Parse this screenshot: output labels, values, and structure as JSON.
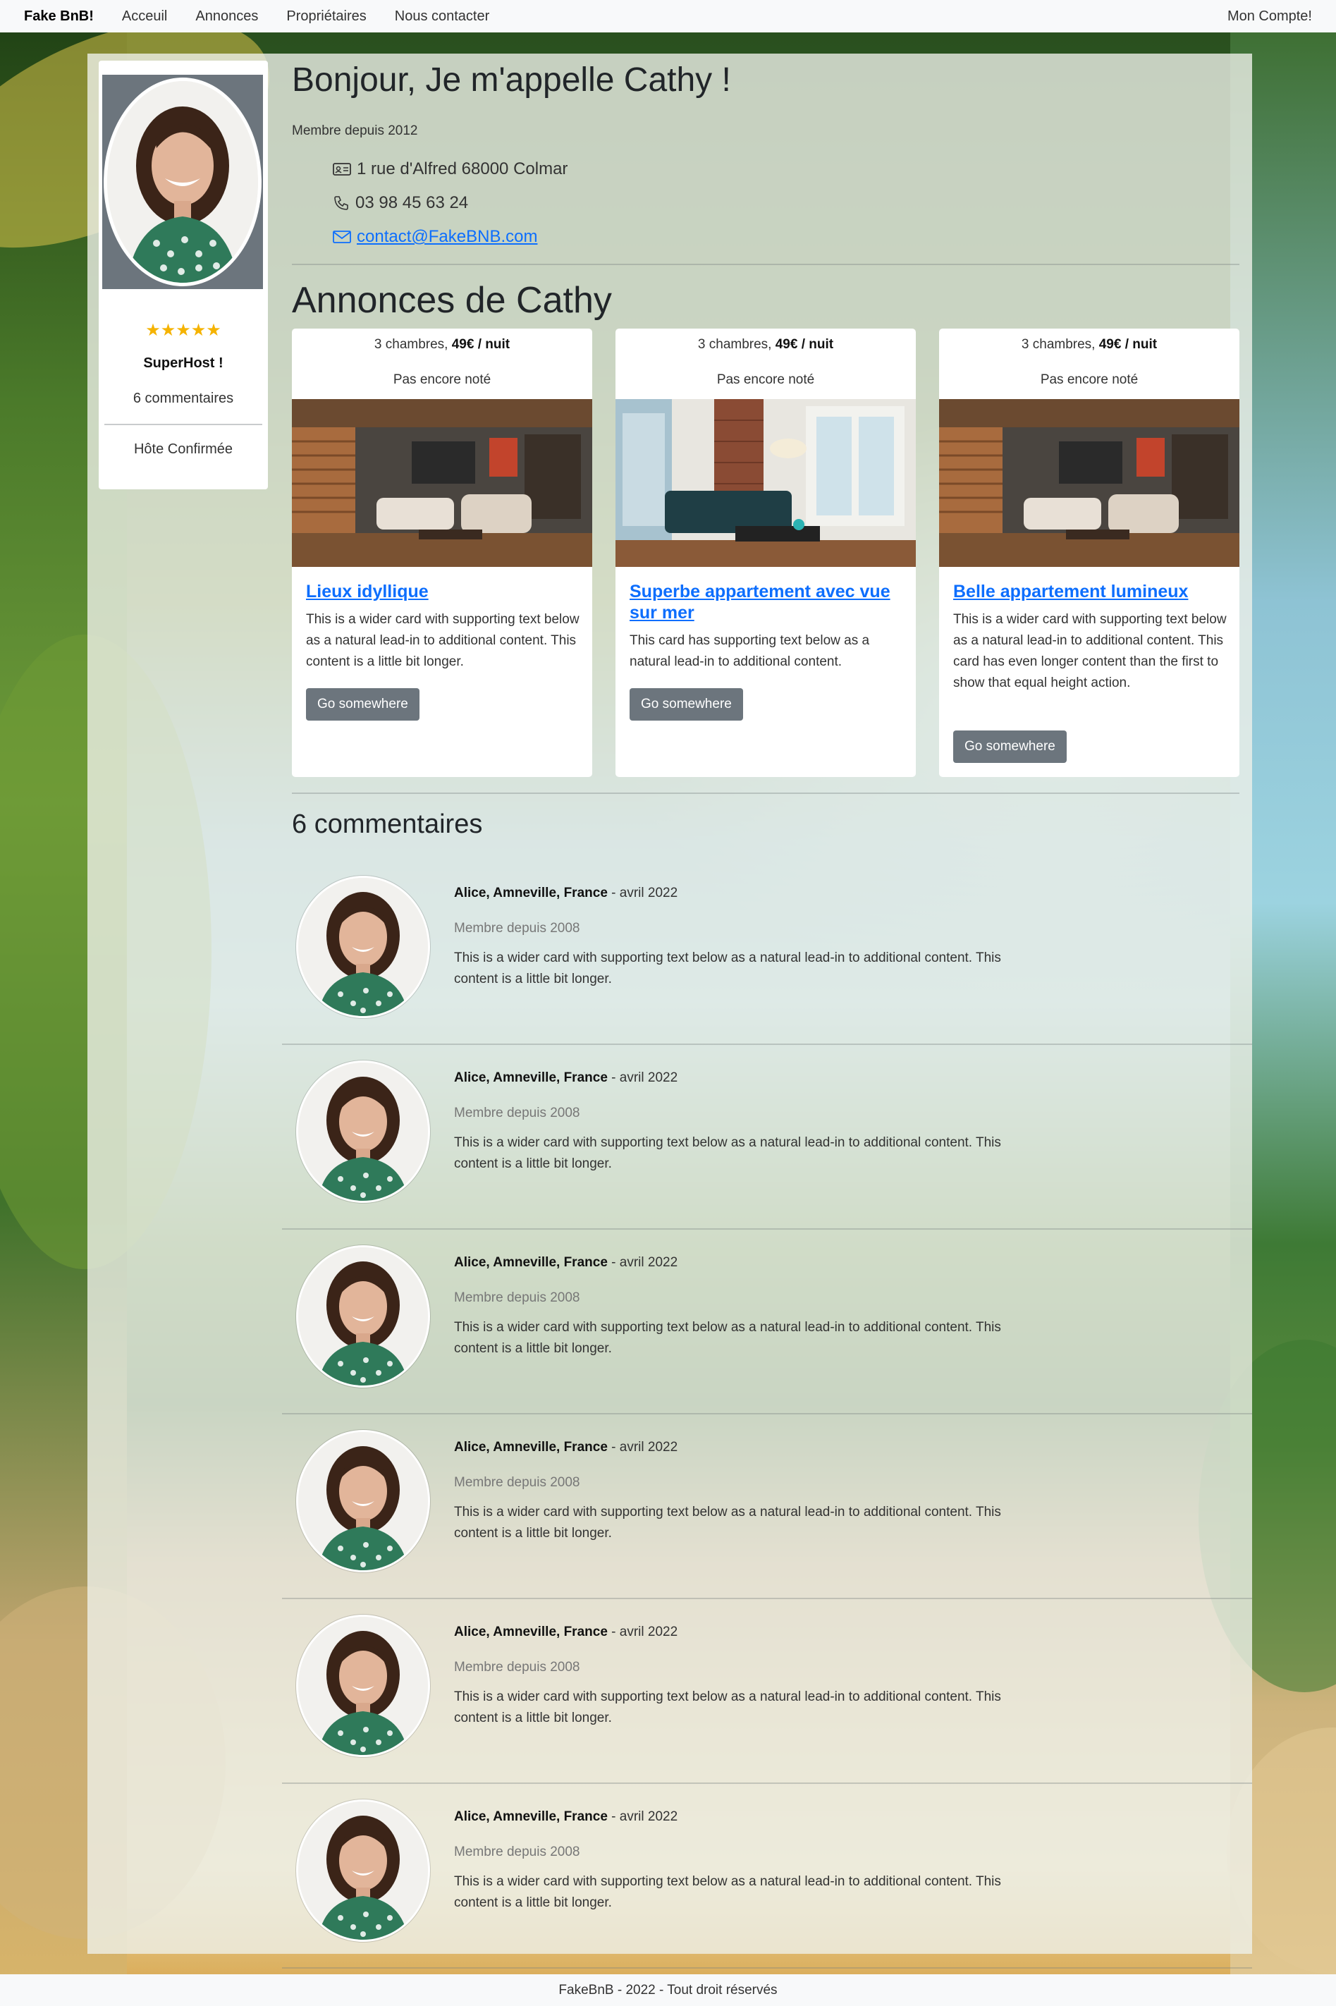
{
  "navbar": {
    "brand": "Fake BnB!",
    "links": [
      "Acceuil",
      "Annonces",
      "Propriétaires",
      "Nous contacter"
    ],
    "account": "Mon Compte!"
  },
  "profile": {
    "stars": "★★★★★",
    "badge": "SuperHost !",
    "comments_count": "6 commentaires",
    "status": "Hôte Confirmée"
  },
  "header": {
    "title": "Bonjour, Je m'appelle Cathy !",
    "member_since": "Membre depuis 2012",
    "address": "1 rue d'Alfred 68000 Colmar",
    "phone": "03 98 45 63 24",
    "email": "contact@FakeBNB.com"
  },
  "listings": {
    "heading": "Annonces de Cathy",
    "items": [
      {
        "rooms": "3 chambres, ",
        "price": "49€ / nuit",
        "rating": "Pas encore noté",
        "title": "Lieux idyllique",
        "text": "This is a wider card with supporting text below as a natural lead-in to additional content. This content is a little bit longer.",
        "button": "Go somewhere"
      },
      {
        "rooms": "3 chambres, ",
        "price": "49€ / nuit",
        "rating": "Pas encore noté",
        "title": "Superbe appartement avec vue sur mer",
        "text": "This card has supporting text below as a natural lead-in to additional content.",
        "button": "Go somewhere"
      },
      {
        "rooms": "3 chambres, ",
        "price": "49€ / nuit",
        "rating": "Pas encore noté",
        "title": "Belle appartement lumineux",
        "text": "This is a wider card with supporting text below as a natural lead-in to additional content. This card has even longer content than the first to show that equal height action.",
        "button": "Go somewhere"
      }
    ]
  },
  "comments": {
    "heading": "6 commentaires",
    "items": [
      {
        "author": "Alice, Amneville, France",
        "date": " - avril 2022",
        "since": "Membre depuis 2008",
        "text": "This is a wider card with supporting text below as a natural lead-in to additional content. This content is a little bit longer."
      },
      {
        "author": "Alice, Amneville, France",
        "date": " - avril 2022",
        "since": "Membre depuis 2008",
        "text": "This is a wider card with supporting text below as a natural lead-in to additional content. This content is a little bit longer."
      },
      {
        "author": "Alice, Amneville, France",
        "date": " - avril 2022",
        "since": "Membre depuis 2008",
        "text": "This is a wider card with supporting text below as a natural lead-in to additional content. This content is a little bit longer."
      },
      {
        "author": "Alice, Amneville, France",
        "date": " - avril 2022",
        "since": "Membre depuis 2008",
        "text": "This is a wider card with supporting text below as a natural lead-in to additional content. This content is a little bit longer."
      },
      {
        "author": "Alice, Amneville, France",
        "date": " - avril 2022",
        "since": "Membre depuis 2008",
        "text": "This is a wider card with supporting text below as a natural lead-in to additional content. This content is a little bit longer."
      },
      {
        "author": "Alice, Amneville, France",
        "date": " - avril 2022",
        "since": "Membre depuis 2008",
        "text": "This is a wider card with supporting text below as a natural lead-in to additional content. This content is a little bit longer."
      }
    ]
  },
  "footer": {
    "text": "FakeBnB - 2022 - Tout droit réservés"
  },
  "colors": {
    "link": "#0d6efd",
    "button": "#6c757d",
    "star": "#f5b301",
    "navbar_bg": "#f8f9fa"
  }
}
